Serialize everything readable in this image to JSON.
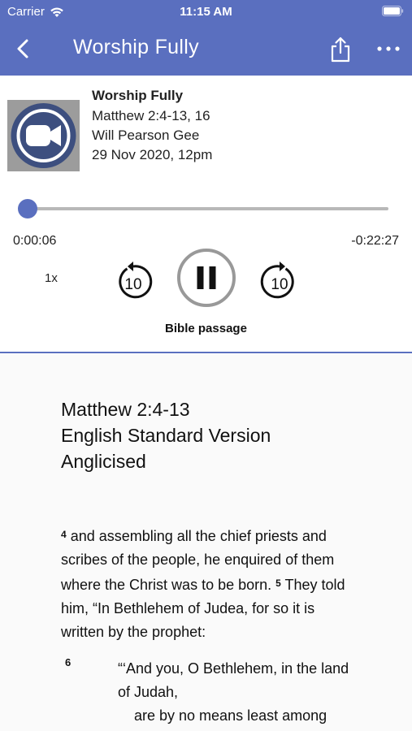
{
  "status_bar": {
    "carrier": "Carrier",
    "time": "11:15 AM"
  },
  "nav": {
    "title": "Worship Fully"
  },
  "episode": {
    "title": "Worship Fully",
    "passage": "Matthew 2:4-13, 16",
    "speaker": "Will Pearson Gee",
    "date": "29 Nov 2020, 12pm"
  },
  "player": {
    "elapsed": "0:00:06",
    "remaining": "-0:22:27",
    "progress_fraction": 0.004,
    "speed": "1x",
    "skip_back_label": "10",
    "skip_forward_label": "10",
    "state": "playing"
  },
  "tab": {
    "label": "Bible passage"
  },
  "reading": {
    "reference": "Matthew 2:4-13",
    "version_line1": "English Standard Version",
    "version_line2": "Anglicised",
    "verse4_num": "4",
    "verse4_text": "and assembling all the chief priests and scribes of the people, he enquired of them where the Christ was to be born.",
    "verse5_num": "5",
    "verse5_text": "They told him, “In Bethlehem of Judea, for so it is written by the prophet:",
    "verse6_num": "6",
    "verse6_line1": "“‘And you, O Bethlehem, in the land of Judah,",
    "verse6_line2": "are by no means least among"
  },
  "colors": {
    "accent": "#5a6fbf",
    "header_text": "#ffffff"
  }
}
